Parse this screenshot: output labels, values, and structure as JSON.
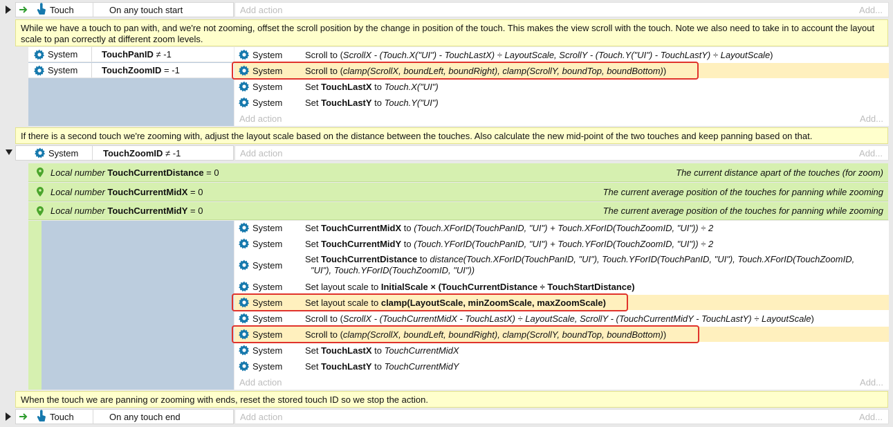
{
  "colors": {
    "gear": "#1679ad",
    "pin": "#4aa52c",
    "highlight_border": "#e0332c",
    "arrow": "#2e9c2e",
    "hand": "#1679ad"
  },
  "add_action": "Add action",
  "add_more": "Add...",
  "event1": {
    "object": "Touch",
    "condition": "On any touch start"
  },
  "comment1": "While we have a touch to pan with, and we're not zooming, offset the scroll position by the change in position of the touch. This makes the view scroll with the touch. Note we also need to take in to account the layout scale to pan correctly at different zoom levels.",
  "system": "System",
  "sub1": {
    "cond1_var": "TouchPanID",
    "cond1_op": " ≠ -1",
    "cond2_var": "TouchZoomID",
    "cond2_op": " = -1",
    "a1_pre": "Scroll to (",
    "a1_expr": "ScrollX - (Touch.X(\"UI\") - TouchLastX) ÷ LayoutScale, ScrollY - (Touch.Y(\"UI\") - TouchLastY) ÷ LayoutScale",
    "a1_post": ")",
    "a2_pre": "Scroll to (",
    "a2_expr": "clamp(ScrollX, boundLeft, boundRight), clamp(ScrollY, boundTop, boundBottom)",
    "a2_post": ")",
    "a3_pre": "Set ",
    "a3_var": "TouchLastX",
    "a3_mid": " to ",
    "a3_expr": "Touch.X(\"UI\")",
    "a4_pre": "Set ",
    "a4_var": "TouchLastY",
    "a4_mid": " to ",
    "a4_expr": "Touch.Y(\"UI\")"
  },
  "comment2": "If there is a second touch we're zooming with, adjust the layout scale based on the distance between the touches. Also calculate the new mid-point of the two touches and keep panning based on that.",
  "sub2": {
    "cond_var": "TouchZoomID",
    "cond_op": " ≠ -1",
    "locals": [
      {
        "kind": "Local number ",
        "name": "TouchCurrentDistance",
        "value": " = 0",
        "comment": "The current distance apart of the touches (for zoom)"
      },
      {
        "kind": "Local number ",
        "name": "TouchCurrentMidX",
        "value": " = 0",
        "comment": "The current average position of the touches for panning while zooming"
      },
      {
        "kind": "Local number ",
        "name": "TouchCurrentMidY",
        "value": " = 0",
        "comment": "The current average position of the touches for panning while zooming"
      }
    ],
    "b1_var": "TouchCurrentMidX",
    "b1_expr": "(Touch.XForID(TouchPanID, \"UI\") + Touch.XForID(TouchZoomID, \"UI\")) ÷ 2",
    "b2_var": "TouchCurrentMidY",
    "b2_expr": "(Touch.YForID(TouchPanID, \"UI\") + Touch.YForID(TouchZoomID, \"UI\")) ÷ 2",
    "b3_var": "TouchCurrentDistance",
    "b3_expr1": "distance(Touch.XForID(TouchPanID, \"UI\"), Touch.YForID(TouchPanID, \"UI\"), Touch.XForID(TouchZoomID,",
    "b3_expr2": "\"UI\"), Touch.YForID(TouchZoomID, \"UI\"))",
    "b4_pre": "Set layout scale to ",
    "b4_expr": "InitialScale × (TouchCurrentDistance ÷ TouchStartDistance)",
    "b5_pre": "Set layout scale to ",
    "b5_expr": "clamp(LayoutScale, minZoomScale, maxZoomScale)",
    "b6_expr": "ScrollX - (TouchCurrentMidX - TouchLastX) ÷ LayoutScale, ScrollY - (TouchCurrentMidY - TouchLastY) ÷ LayoutScale",
    "b7_expr": "clamp(ScrollX, boundLeft, boundRight), clamp(ScrollY, boundTop, boundBottom)",
    "b8_var": "TouchLastX",
    "b8_expr": "TouchCurrentMidX",
    "b9_var": "TouchLastY",
    "b9_expr": "TouchCurrentMidY"
  },
  "comment3": "When the touch we are panning or zooming with ends, reset the stored touch ID so we stop the action.",
  "event3": {
    "object": "Touch",
    "condition": "On any touch end"
  },
  "labels": {
    "set": "Set ",
    "to": " to ",
    "scroll_to": "Scroll to ("
  }
}
